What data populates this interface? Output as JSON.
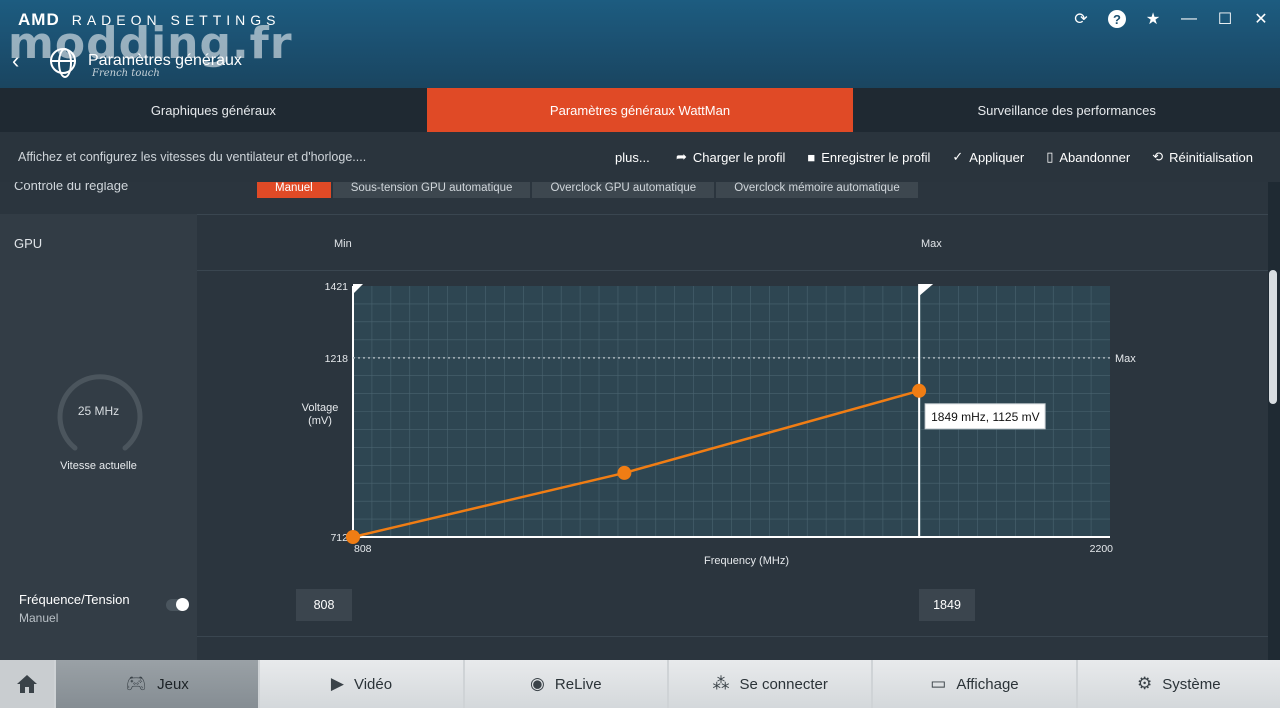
{
  "app": {
    "brand_amd": "AMD",
    "brand_name": "RADEON SETTINGS",
    "watermark": "modding.fr",
    "watermark_sub": "French touch",
    "page_title": "Paramètres généraux"
  },
  "tabs": [
    {
      "label": "Graphiques généraux",
      "active": false
    },
    {
      "label": "Paramètres généraux WattMan",
      "active": true
    },
    {
      "label": "Surveillance des performances",
      "active": false
    }
  ],
  "actionbar": {
    "description": "Affichez et configurez les vitesses du ventilateur et d'horloge....",
    "more": "plus...",
    "actions": [
      {
        "label": "Charger le profil",
        "icon": "share-arrow-icon"
      },
      {
        "label": "Enregistrer le profil",
        "icon": "floppy-icon"
      },
      {
        "label": "Appliquer",
        "icon": "check-icon"
      },
      {
        "label": "Abandonner",
        "icon": "trash-icon"
      },
      {
        "label": "Réinitialisation",
        "icon": "reset-icon"
      }
    ]
  },
  "control": {
    "label": "Contrôle du réglage",
    "options": [
      {
        "label": "Manuel",
        "selected": true
      },
      {
        "label": "Sous-tension GPU automatique",
        "selected": false
      },
      {
        "label": "Overclock GPU automatique",
        "selected": false
      },
      {
        "label": "Overclock mémoire automatique",
        "selected": false
      }
    ]
  },
  "gpu": {
    "label": "GPU",
    "min_label": "Min",
    "max_label": "Max"
  },
  "gauge": {
    "value": "25 MHz",
    "caption": "Vitesse actuelle",
    "fraction": 0.0
  },
  "chart_data": {
    "type": "line",
    "ylabel_line1": "Voltage",
    "ylabel_line2": "(mV)",
    "xlabel": "Frequency (MHz)",
    "xlim": [
      808,
      2200
    ],
    "ylim": [
      712,
      1421
    ],
    "x_tick_labels": [
      "808",
      "2200"
    ],
    "y_tick_labels": [
      "1421",
      "1218",
      "712"
    ],
    "max_voltage_line": 1218,
    "max_voltage_label": "Max",
    "min_frequency_marker": 808,
    "max_frequency_marker": 1849,
    "series": [
      {
        "x": [
          808,
          1307,
          1849
        ],
        "y": [
          712,
          893,
          1125
        ],
        "color": "#f07d14"
      }
    ],
    "tooltip": "1849 mHz, 1125 mV"
  },
  "freq_tension": {
    "title": "Fréquence/Tension",
    "subtitle": "Manuel",
    "enabled": true,
    "min_value": "808",
    "max_value": "1849"
  },
  "bottomnav": [
    {
      "label": "Jeux",
      "icon": "gamepad-icon",
      "active": true
    },
    {
      "label": "Vidéo",
      "icon": "play-icon",
      "active": false
    },
    {
      "label": "ReLive",
      "icon": "relive-icon",
      "active": false
    },
    {
      "label": "Se connecter",
      "icon": "share-nodes-icon",
      "active": false
    },
    {
      "label": "Affichage",
      "icon": "monitor-icon",
      "active": false
    },
    {
      "label": "Système",
      "icon": "gear-icon",
      "active": false
    }
  ]
}
